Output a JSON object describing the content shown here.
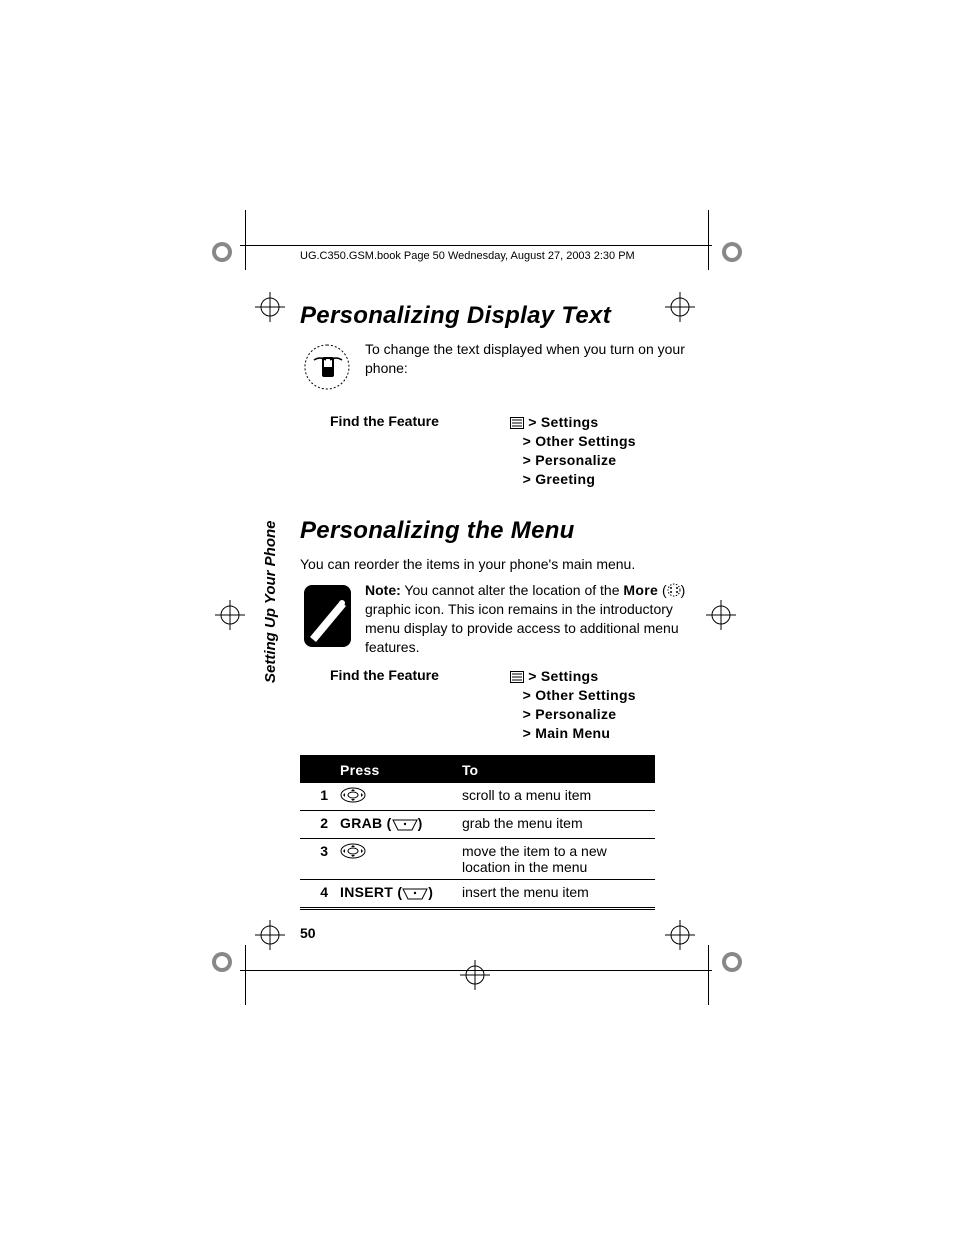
{
  "runhead": "UG.C350.GSM.book  Page 50  Wednesday, August 27, 2003  2:30 PM",
  "side_tab": "Setting Up Your Phone",
  "page_number": "50",
  "section1": {
    "title": "Personalizing Display Text",
    "intro": "To change the text displayed when you turn on your phone:",
    "find_label": "Find the Feature",
    "path": {
      "root": "Settings",
      "items": [
        "Other Settings",
        "Personalize",
        "Greeting"
      ]
    }
  },
  "section2": {
    "title": "Personalizing the Menu",
    "intro": "You can reorder the items in your phone's main menu.",
    "note_label": "Note:",
    "note_prefix": " You cannot alter the location of the ",
    "note_more": "More",
    "note_suffix": " graphic icon. This icon remains in the introductory menu display to provide access to additional menu features.",
    "find_label": "Find the Feature",
    "path": {
      "root": "Settings",
      "items": [
        "Other Settings",
        "Personalize",
        "Main Menu"
      ]
    },
    "table": {
      "headers": {
        "press": "Press",
        "to": "To"
      },
      "rows": [
        {
          "step": "1",
          "press_type": "nav",
          "press_text": "",
          "to": "scroll to a menu item"
        },
        {
          "step": "2",
          "press_type": "softkey",
          "press_text": "GRAB",
          "to": "grab the menu item"
        },
        {
          "step": "3",
          "press_type": "nav",
          "press_text": "",
          "to": "move the item to a new location in the menu"
        },
        {
          "step": "4",
          "press_type": "softkey",
          "press_text": "INSERT",
          "to": "insert the menu item"
        }
      ]
    }
  }
}
